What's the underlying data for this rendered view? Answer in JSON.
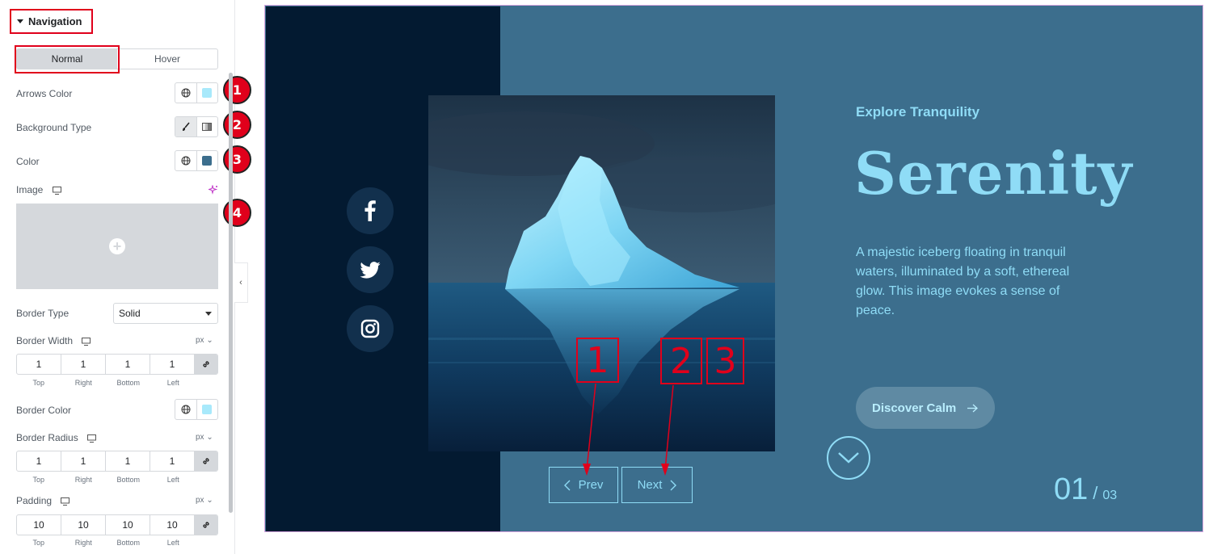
{
  "panel": {
    "section_title": "Navigation",
    "tabs": [
      {
        "label": "Normal",
        "active": true
      },
      {
        "label": "Hover",
        "active": false
      }
    ],
    "arrows_color": {
      "label": "Arrows Color",
      "value": "#a8e9fb"
    },
    "background_type": {
      "label": "Background Type"
    },
    "color": {
      "label": "Color",
      "value": "#3c6e8d"
    },
    "image": {
      "label": "Image"
    },
    "border_type": {
      "label": "Border Type",
      "value": "Solid"
    },
    "border_width": {
      "label": "Border Width",
      "unit": "px",
      "values": [
        "1",
        "1",
        "1",
        "1"
      ]
    },
    "border_color": {
      "label": "Border Color",
      "value": "#a8e9fb"
    },
    "border_radius": {
      "label": "Border Radius",
      "unit": "px",
      "values": [
        "1",
        "1",
        "1",
        "1"
      ]
    },
    "padding": {
      "label": "Padding",
      "unit": "px",
      "values": [
        "10",
        "10",
        "10",
        "10"
      ]
    },
    "dim_labels": [
      "Top",
      "Right",
      "Bottom",
      "Left"
    ],
    "badges": [
      "1",
      "2",
      "3",
      "4"
    ]
  },
  "preview": {
    "eyebrow": "Explore Tranquility",
    "headline": "Serenity",
    "description": "A majestic iceberg floating in tranquil waters, illuminated by a soft, ethereal glow. This image evokes a sense of peace.",
    "cta_label": "Discover Calm",
    "prev_label": "Prev",
    "next_label": "Next",
    "counter_current": "01",
    "counter_separator": "/",
    "counter_total": "03",
    "social_icons": [
      "facebook-icon",
      "twitter-icon",
      "instagram-icon"
    ],
    "annotations": [
      "1",
      "2",
      "3"
    ]
  },
  "colors": {
    "accent_red": "#e0001b",
    "slide_bg": "#3c6e8d",
    "dark_strip": "#031a31",
    "text_cyan": "#8fdcf6"
  }
}
